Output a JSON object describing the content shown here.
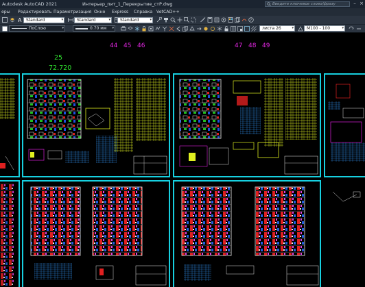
{
  "titlebar": {
    "app_title": "Autodesk AutoCAD 2021",
    "file_title": "Интерьер_пит_1_Перекрытие_стР.dwg",
    "search_placeholder": "Введите ключевое слово/фразу",
    "minimize": "–",
    "close": "×"
  },
  "menubar": {
    "items": [
      "еры",
      "Редактировать",
      "Параметризация",
      "Окно",
      "Express",
      "Справка",
      "VetCAD++"
    ]
  },
  "toolbar1": {
    "text_style": "Standard",
    "dim_style": "Standard"
  },
  "toolbar2": {
    "linetype": "ПоСлою",
    "lineweight": "0.70 мм",
    "sheet_name": "листа 26",
    "scale": "M100 - 100"
  },
  "canvas": {
    "sheet_numbers_left": [
      "44",
      "45",
      "46"
    ],
    "sheet_numbers_right": [
      "47",
      "48",
      "49"
    ],
    "marker_number": "25",
    "marker_value": "72.720"
  },
  "colors": {
    "sheet_border": "#17d0e0",
    "magenta": "#e026e0",
    "green": "#2fe02f",
    "background": "#000000"
  }
}
